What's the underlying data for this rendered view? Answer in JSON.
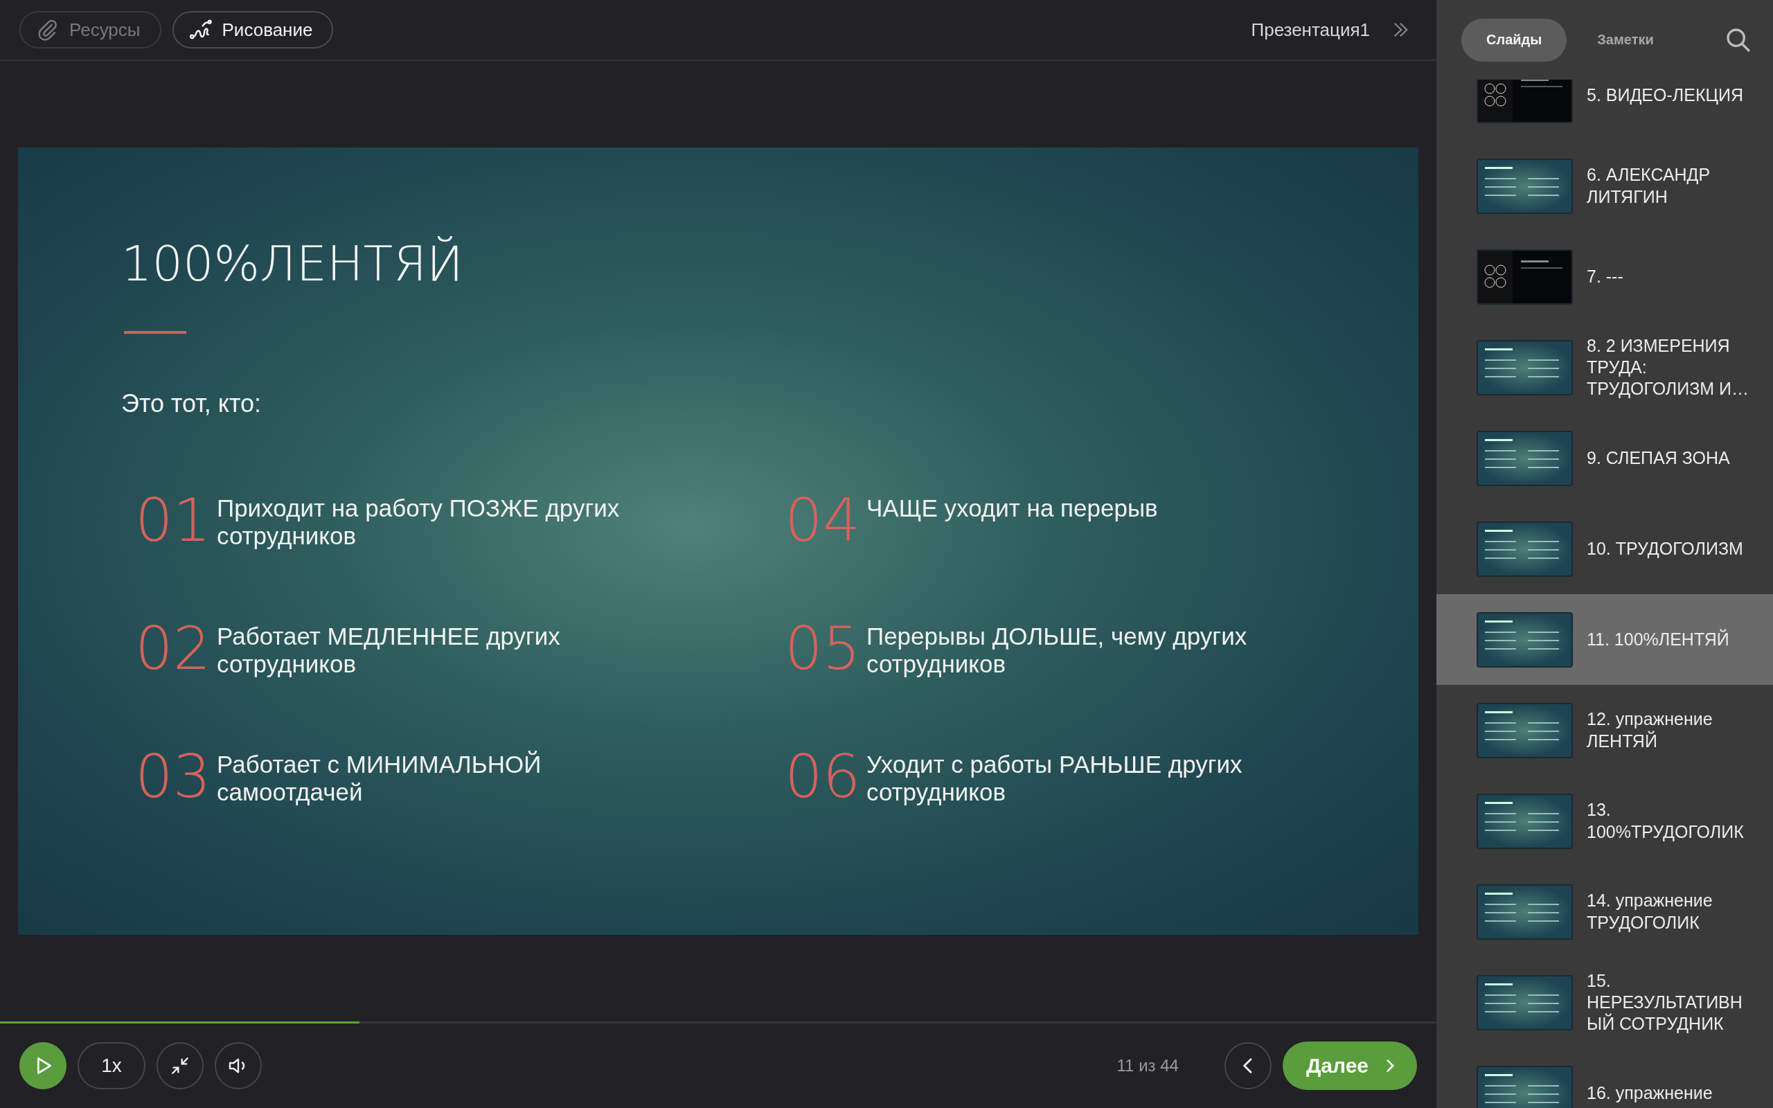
{
  "toolbar": {
    "buttons": [
      {
        "label": "Ресурсы",
        "disabled": true
      },
      {
        "label": "Рисование",
        "disabled": false
      }
    ],
    "presentation_title": "Презентация1"
  },
  "slide": {
    "title": "100%ЛЕНТЯЙ",
    "intro": "Это тот, кто:",
    "items": [
      {
        "number": "01",
        "text": "Приходит на работу ПОЗЖЕ других сотрудников"
      },
      {
        "number": "04",
        "text": "ЧАЩЕ уходит на перерыв"
      },
      {
        "number": "02",
        "text": "Работает МЕДЛЕННЕЕ других сотрудников"
      },
      {
        "number": "05",
        "text": "Перерывы ДОЛЬШЕ, чему других сотрудников"
      },
      {
        "number": "03",
        "text": "Работает с МИНИМАЛЬНОЙ самоотдачей"
      },
      {
        "number": "06",
        "text": "Уходит с работы РАНЬШЕ других сотрудников"
      }
    ]
  },
  "player": {
    "progress": {
      "level": 0.25
    },
    "speed": "1x",
    "counter": "11 из 44",
    "next_label": "Далее"
  },
  "sidebar": {
    "tabs": [
      {
        "label": "Слайды",
        "selected": true
      },
      {
        "label": "Заметки",
        "selected": false
      }
    ],
    "slides": [
      {
        "label": "5. ВИДЕО-ЛЕКЦИЯ",
        "kind": "dark",
        "selected": false
      },
      {
        "label": "6. АЛЕКСАНДР ЛИТЯГИН",
        "kind": "text",
        "selected": false
      },
      {
        "label": "7. ---",
        "kind": "dark",
        "selected": false
      },
      {
        "label": "8. 2 ИЗМЕРЕНИЯ ТРУДА: ТРУДОГОЛИЗМ И…",
        "kind": "text",
        "selected": false
      },
      {
        "label": "9. СЛЕПАЯ ЗОНА",
        "kind": "text",
        "selected": false
      },
      {
        "label": "10. ТРУДОГОЛИЗМ",
        "kind": "text",
        "selected": false
      },
      {
        "label": "11. 100%ЛЕНТЯЙ",
        "kind": "text",
        "selected": true
      },
      {
        "label": "12. упражнение ЛЕНТЯЙ",
        "kind": "text",
        "selected": false
      },
      {
        "label": "13. 100%ТРУДОГОЛИК",
        "kind": "text",
        "selected": false
      },
      {
        "label": "14. упражнение ТРУДОГОЛИК",
        "kind": "text",
        "selected": false
      },
      {
        "label": "15. НЕРЕЗУЛЬТАТИВНЫЙ СОТРУДНИК",
        "kind": "text",
        "selected": false
      },
      {
        "label": "16. упражнение",
        "kind": "text",
        "selected": false
      }
    ]
  }
}
